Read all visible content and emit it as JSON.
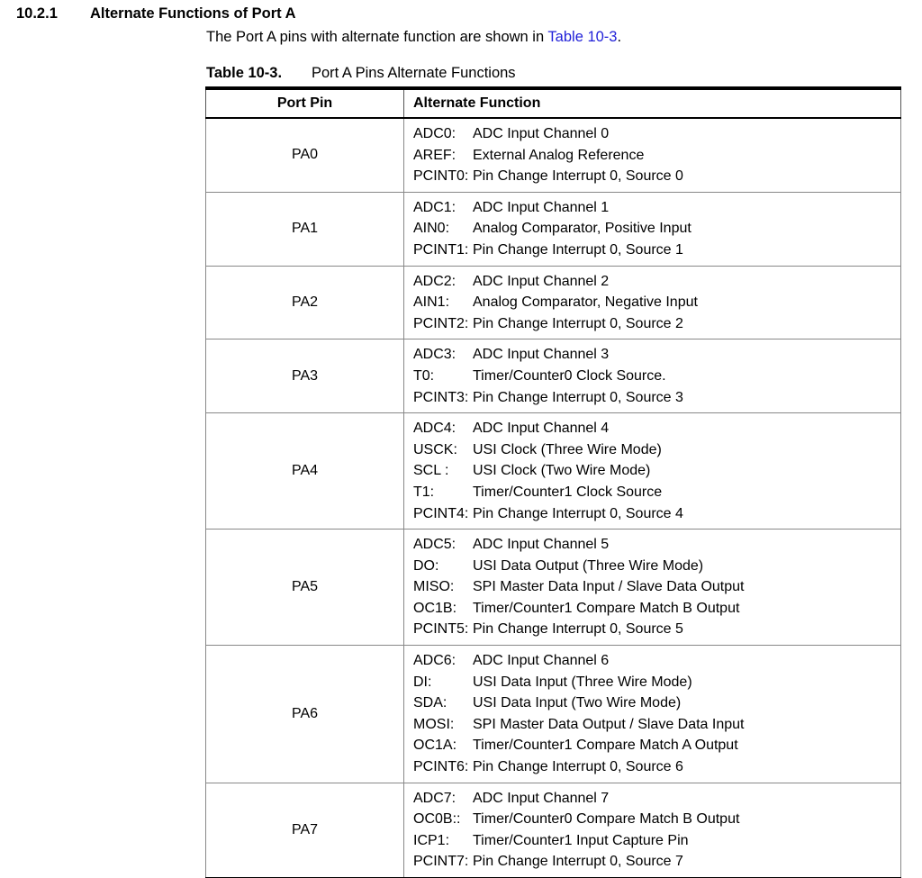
{
  "heading": {
    "number": "10.2.1",
    "title": "Alternate Functions of Port A"
  },
  "intro": {
    "text_before": "The Port A pins with alternate function are shown in ",
    "link": "Table 10-3",
    "text_after": "."
  },
  "caption": {
    "label": "Table 10-3.",
    "title": "Port A Pins Alternate Functions"
  },
  "table": {
    "headers": [
      "Port Pin",
      "Alternate Function"
    ],
    "rows": [
      {
        "pin": "PA0",
        "functions": [
          {
            "signal": "ADC0:",
            "desc": "ADC Input Channel 0"
          },
          {
            "signal": "AREF:",
            "desc": "External Analog Reference"
          },
          {
            "signal": "PCINT0:",
            "desc": "Pin Change Interrupt 0, Source 0"
          }
        ]
      },
      {
        "pin": "PA1",
        "functions": [
          {
            "signal": "ADC1:",
            "desc": "ADC Input Channel 1"
          },
          {
            "signal": "AIN0:",
            "desc": "Analog Comparator, Positive Input"
          },
          {
            "signal": "PCINT1:",
            "desc": "Pin Change Interrupt 0, Source 1"
          }
        ]
      },
      {
        "pin": "PA2",
        "functions": [
          {
            "signal": "ADC2:",
            "desc": "ADC Input Channel 2"
          },
          {
            "signal": "AIN1:",
            "desc": "Analog Comparator, Negative Input"
          },
          {
            "signal": "PCINT2:",
            "desc": "Pin Change Interrupt 0, Source 2"
          }
        ]
      },
      {
        "pin": "PA3",
        "functions": [
          {
            "signal": "ADC3:",
            "desc": "ADC Input Channel 3"
          },
          {
            "signal": "T0:",
            "desc": "Timer/Counter0 Clock Source."
          },
          {
            "signal": "PCINT3:",
            "desc": "Pin Change Interrupt 0, Source 3"
          }
        ]
      },
      {
        "pin": "PA4",
        "functions": [
          {
            "signal": "ADC4:",
            "desc": "ADC Input Channel 4"
          },
          {
            "signal": "USCK:",
            "desc": "USI Clock (Three Wire Mode)"
          },
          {
            "signal": "SCL :",
            "desc": "USI Clock (Two Wire Mode)"
          },
          {
            "signal": "T1:",
            "desc": "Timer/Counter1 Clock Source"
          },
          {
            "signal": "PCINT4:",
            "desc": "Pin Change Interrupt 0, Source 4"
          }
        ]
      },
      {
        "pin": "PA5",
        "functions": [
          {
            "signal": "ADC5:",
            "desc": "ADC Input Channel 5"
          },
          {
            "signal": "DO:",
            "desc": "USI Data Output (Three Wire Mode)"
          },
          {
            "signal": "MISO:",
            "desc": "SPI Master Data Input / Slave Data Output"
          },
          {
            "signal": "OC1B:",
            "desc": "Timer/Counter1 Compare Match B Output"
          },
          {
            "signal": "PCINT5:",
            "desc": "Pin Change Interrupt 0, Source 5"
          }
        ]
      },
      {
        "pin": "PA6",
        "functions": [
          {
            "signal": "ADC6:",
            "desc": "ADC Input Channel 6"
          },
          {
            "signal": "DI:",
            "desc": "USI Data Input (Three Wire Mode)"
          },
          {
            "signal": "SDA:",
            "desc": "USI Data Input (Two Wire Mode)"
          },
          {
            "signal": "MOSI:",
            "desc": "SPI Master Data Output / Slave Data Input"
          },
          {
            "signal": "OC1A:",
            "desc": "Timer/Counter1 Compare Match A Output"
          },
          {
            "signal": "PCINT6:",
            "desc": "Pin Change Interrupt 0, Source 6"
          }
        ]
      },
      {
        "pin": "PA7",
        "functions": [
          {
            "signal": "ADC7:",
            "desc": "ADC Input Channel 7"
          },
          {
            "signal": "OC0B::",
            "desc": "Timer/Counter0 Compare Match B Output"
          },
          {
            "signal": "ICP1:",
            "desc": "Timer/Counter1 Input Capture Pin"
          },
          {
            "signal": "PCINT7:",
            "desc": "Pin Change Interrupt 0, Source 7"
          }
        ]
      }
    ]
  },
  "colors": {
    "link": "#1f1fd8",
    "text": "#000000",
    "border": "#888888"
  }
}
